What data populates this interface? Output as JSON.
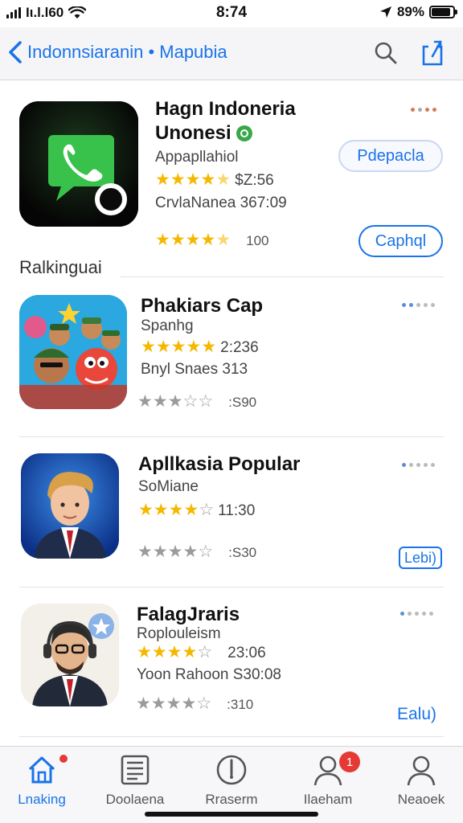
{
  "status_bar": {
    "carrier": "Iι.l.l60",
    "time": "8:74",
    "battery": "89%",
    "battery_level": 0.89
  },
  "nav": {
    "back_label": "Indonnsiaranin • Mapubia"
  },
  "section_label": "Ralkinguai",
  "apps": [
    {
      "title_line1": "Hagn Indoneria",
      "title_line2": "Unonesi",
      "subtitle": "Appapllahiol",
      "rating_text": "$Z:56",
      "stars": 4.5,
      "meta": "CrvlaNanea 367:09",
      "count": "100",
      "primary_button": "Pdepacla",
      "secondary_button": "Caphql"
    },
    {
      "title": "Phakiars Cap",
      "subtitle": "Spanhg",
      "rating_text": "2:236",
      "stars": 5,
      "meta": "Bnyl Snaes 313",
      "count": ":S90"
    },
    {
      "title": "Apllkasia Popular",
      "subtitle": "SoMiane",
      "rating_text": "11:30",
      "stars": 4,
      "count": ":S30",
      "button": "Lebi)"
    },
    {
      "title": "FalagJraris",
      "subtitle": "Roplouleism",
      "rating_text": "23:06",
      "stars": 4,
      "meta": "Yoon Rahoon S30:08",
      "count": ":310",
      "button": "Ealu)"
    }
  ],
  "tabs": [
    {
      "label": "Lnaking",
      "icon": "home-icon"
    },
    {
      "label": "Doolaena",
      "icon": "news-icon"
    },
    {
      "label": "Rraserm",
      "icon": "compass-icon"
    },
    {
      "label": "Ilaeham",
      "icon": "person-icon",
      "badge": "1"
    },
    {
      "label": "Neaoek",
      "icon": "person-icon"
    }
  ],
  "colors": {
    "accent": "#1a73e8",
    "star": "#f5b800",
    "badge": "#e53935"
  }
}
